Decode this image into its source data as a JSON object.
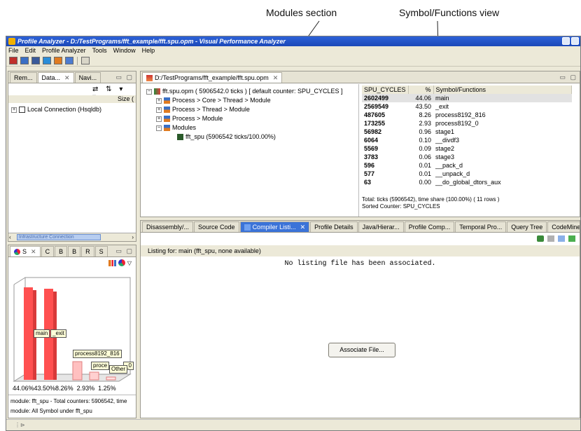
{
  "annotations": {
    "modules": "Modules section",
    "symbol_view": "Symbol/Functions view"
  },
  "window": {
    "title": "Profile Analyzer - D:/TestPrograms/fft_example/fft.spu.opm - Visual Performance Analyzer"
  },
  "menu": [
    "File",
    "Edit",
    "Profile Analyzer",
    "Tools",
    "Window",
    "Help"
  ],
  "left_top": {
    "tabs": [
      "Rem...",
      "Data...",
      "Navi..."
    ],
    "size_header": "Size (",
    "tree_item": "Local Connection (Hsqldb)"
  },
  "editor": {
    "tab": "D:/TestPrograms/fft_example/fft.spu.opm",
    "tree": {
      "root": "fft.spu.opm ( 5906542.0 ticks ) [ default counter: SPU_CYCLES ]",
      "items": [
        "Process > Core > Thread > Module",
        "Process > Thread > Module",
        "Process > Module",
        "Modules"
      ],
      "module": "fft_spu (5906542 ticks/100.00%)"
    },
    "table": {
      "headers": [
        "SPU_CYCLES",
        "%",
        "Symbol/Functions"
      ],
      "rows": [
        {
          "cycles": "2602499",
          "pct": "44.06",
          "sym": "main"
        },
        {
          "cycles": "2569549",
          "pct": "43.50",
          "sym": "_exit"
        },
        {
          "cycles": "487605",
          "pct": "8.26",
          "sym": "process8192_816"
        },
        {
          "cycles": "173255",
          "pct": "2.93",
          "sym": "process8192_0"
        },
        {
          "cycles": "56982",
          "pct": "0.96",
          "sym": "stage1"
        },
        {
          "cycles": "6064",
          "pct": "0.10",
          "sym": "__divdf3"
        },
        {
          "cycles": "5569",
          "pct": "0.09",
          "sym": "stage2"
        },
        {
          "cycles": "3783",
          "pct": "0.06",
          "sym": "stage3"
        },
        {
          "cycles": "596",
          "pct": "0.01",
          "sym": "__pack_d"
        },
        {
          "cycles": "577",
          "pct": "0.01",
          "sym": "__unpack_d"
        },
        {
          "cycles": "63",
          "pct": "0.00",
          "sym": "__do_global_dtors_aux"
        }
      ],
      "footer1": "Total: ticks (5906542), time share (100.00%) ( 11 rows )",
      "footer2": "Sorted Counter: SPU_CYCLES"
    }
  },
  "bottom_tabs": [
    "Disassembly/...",
    "Source Code",
    "Compiler Listi...",
    "Profile Details",
    "Java/Hierar...",
    "Profile Comp...",
    "Temporal Pro...",
    "Query Tree",
    "CodeMiner Q..."
  ],
  "listing": {
    "header": "Listing for: main (fft_spu, none available)",
    "message": "No listing file has been associated.",
    "button": "Associate File..."
  },
  "chart_panel": {
    "tabs": [
      "S",
      "C",
      "B",
      "B",
      "R",
      "S"
    ],
    "labels": [
      "main",
      "_exit",
      "process8192_816",
      "proce",
      "_0",
      "Other"
    ],
    "percents": "44.06%43.50%8.26%  2.93%  1.25%",
    "status1": "module: fft_spu - Total counters: 5906542, time",
    "status2": "module: All Symbol under fft_spu"
  },
  "left_scroll_text": "Infrastructure Connection"
}
